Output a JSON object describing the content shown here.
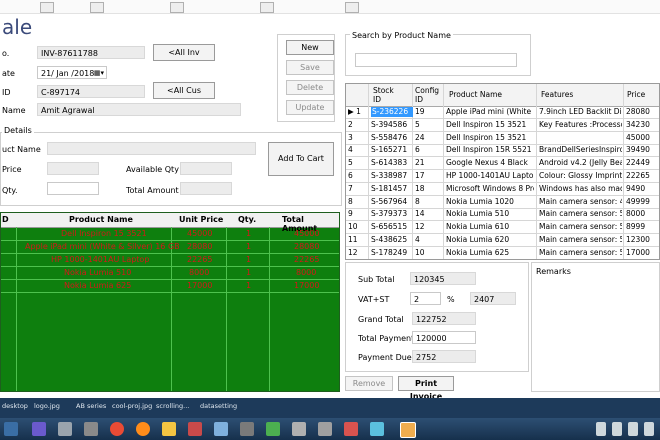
{
  "form": {
    "title": "ale",
    "invoice_label": "o.",
    "invoice_no": "INV-87611788",
    "all_inv_button": "<All Inv",
    "date_label": "ate",
    "date_value": "21/ Jan /2018",
    "customer_id_label": "ID",
    "customer_id": "C-897174",
    "all_cus_button": "<All Cus",
    "name_label": "Name",
    "customer_name": "Amit Agrawal",
    "details_label": "Details",
    "product_name_label": "uct Name",
    "price_label": "Price",
    "available_qty_label": "Available Qty",
    "qty_label": "Qty.",
    "total_amount_label": "Total Amount",
    "add_to_cart_button": "Add To Cart"
  },
  "actions": {
    "new": "New",
    "save": "Save",
    "delete": "Delete",
    "update": "Update"
  },
  "search": {
    "label": "Search by Product Name",
    "value": ""
  },
  "cart": {
    "columns": [
      "D",
      "Product Name",
      "Unit Price",
      "Qty.",
      "Total Amount"
    ],
    "rows": [
      [
        "Dell Inspiron 15 3521",
        "45000",
        "1",
        "45000"
      ],
      [
        "Apple iPad mini (White & Silver) 16 GB",
        "28080",
        "1",
        "28080"
      ],
      [
        "HP 1000-1401AU Laptop",
        "22265",
        "1",
        "22265"
      ],
      [
        "Nokia Lumia 510",
        "8000",
        "1",
        "8000"
      ],
      [
        "Nokia Lumia 625",
        "17000",
        "1",
        "17000"
      ]
    ]
  },
  "stock": {
    "columns": [
      "",
      "Stock ID",
      "Config ID",
      "Product Name",
      "Features",
      "Price"
    ],
    "rows": [
      [
        "▶ 1",
        "S-236226",
        "19",
        "Apple iPad mini (White & ...",
        "7.9inch LED Backlit Disp...",
        "28080"
      ],
      [
        "2",
        "S-394586",
        "5",
        "Dell Inspiron 15 3521",
        "Key Features :Processor...",
        "34230"
      ],
      [
        "3",
        "S-558476",
        "24",
        "Dell Inspiron 15 3521",
        "",
        "45000"
      ],
      [
        "4",
        "S-165271",
        "6",
        "Dell Inspiron 15R 5521",
        "BrandDellSeriesInspiro...",
        "39490"
      ],
      [
        "5",
        "S-614383",
        "21",
        "Google Nexus 4 Black",
        "Android v4.2 (Jelly Bean...",
        "22449"
      ],
      [
        "6",
        "S-338987",
        "17",
        "HP 1000-1401AU Laptop",
        "Colour: Glossy Imprint ...",
        "22265"
      ],
      [
        "7",
        "S-181457",
        "18",
        "Microsoft Windows 8 Pro ...",
        "Windows has also made ...",
        "9490"
      ],
      [
        "8",
        "S-567964",
        "8",
        "Nokia Lumia 1020",
        "Main camera sensor: 41 ...",
        "49999"
      ],
      [
        "9",
        "S-379373",
        "14",
        "Nokia Lumia 510",
        "Main camera sensor: 5 ...",
        "8000"
      ],
      [
        "10",
        "S-656515",
        "12",
        "Nokia Lumia 610",
        "Main camera sensor: 5 ...",
        "8999"
      ],
      [
        "11",
        "S-438625",
        "4",
        "Nokia Lumia 620",
        "Main camera sensor: 5 ...",
        "12300"
      ],
      [
        "12",
        "S-178249",
        "10",
        "Nokia Lumia 625",
        "Main camera sensor: 5 ...",
        "17000"
      ]
    ]
  },
  "totals": {
    "sub_total_label": "Sub Total",
    "sub_total": "120345",
    "vat_label": "VAT+ST",
    "vat_percent": "2",
    "percent_sign": "%",
    "vat_amount": "2407",
    "grand_total_label": "Grand Total",
    "grand_total": "122752",
    "total_payment_label": "Total Payment",
    "total_payment": "120000",
    "payment_due_label": "Payment Due",
    "payment_due": "2752"
  },
  "remarks_label": "Remarks",
  "bottom_buttons": {
    "remove": "Remove",
    "print_invoice": "Print Invoice"
  },
  "file_strip": [
    "desktop",
    "logo.jpg",
    "AB series",
    "cool-proj.jpg",
    "scrolling...",
    "datasetting"
  ],
  "colors": {
    "cart_background": "#0e7f0e",
    "cart_text": "#d31818",
    "selection": "#3399ff"
  }
}
